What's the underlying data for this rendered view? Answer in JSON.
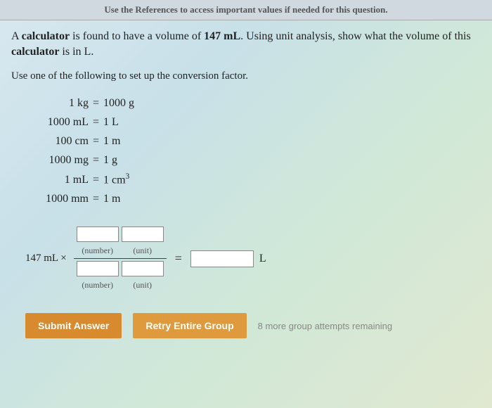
{
  "header": {
    "references_text": "Use the References to access important values if needed for this question."
  },
  "prompt": {
    "line1_pre": "A ",
    "line1_bold1": "calculator",
    "line1_mid": " is found to have a volume of ",
    "line1_bold2": "147 mL",
    "line1_post": ". Using unit analysis, show what the volume of this ",
    "line1_bold3": "calculator",
    "line1_end": " is in L."
  },
  "sub_instruction": "Use one of the following to set up the conversion factor.",
  "conversions": [
    {
      "lhs": "1 kg",
      "rhs": "1000 g"
    },
    {
      "lhs": "1000 mL",
      "rhs": "1 L"
    },
    {
      "lhs": "100 cm",
      "rhs": "1 m"
    },
    {
      "lhs": "1000 mg",
      "rhs": "1 g"
    },
    {
      "lhs": "1 mL",
      "rhs": "1 cm³"
    },
    {
      "lhs": "1000 mm",
      "rhs": "1 m"
    }
  ],
  "work": {
    "given": "147 mL ×",
    "num_label": "(number)",
    "unit_label": "(unit)",
    "equals": "=",
    "output_unit": "L"
  },
  "buttons": {
    "submit": "Submit Answer",
    "retry": "Retry Entire Group"
  },
  "attempts_text": "8 more group attempts remaining"
}
